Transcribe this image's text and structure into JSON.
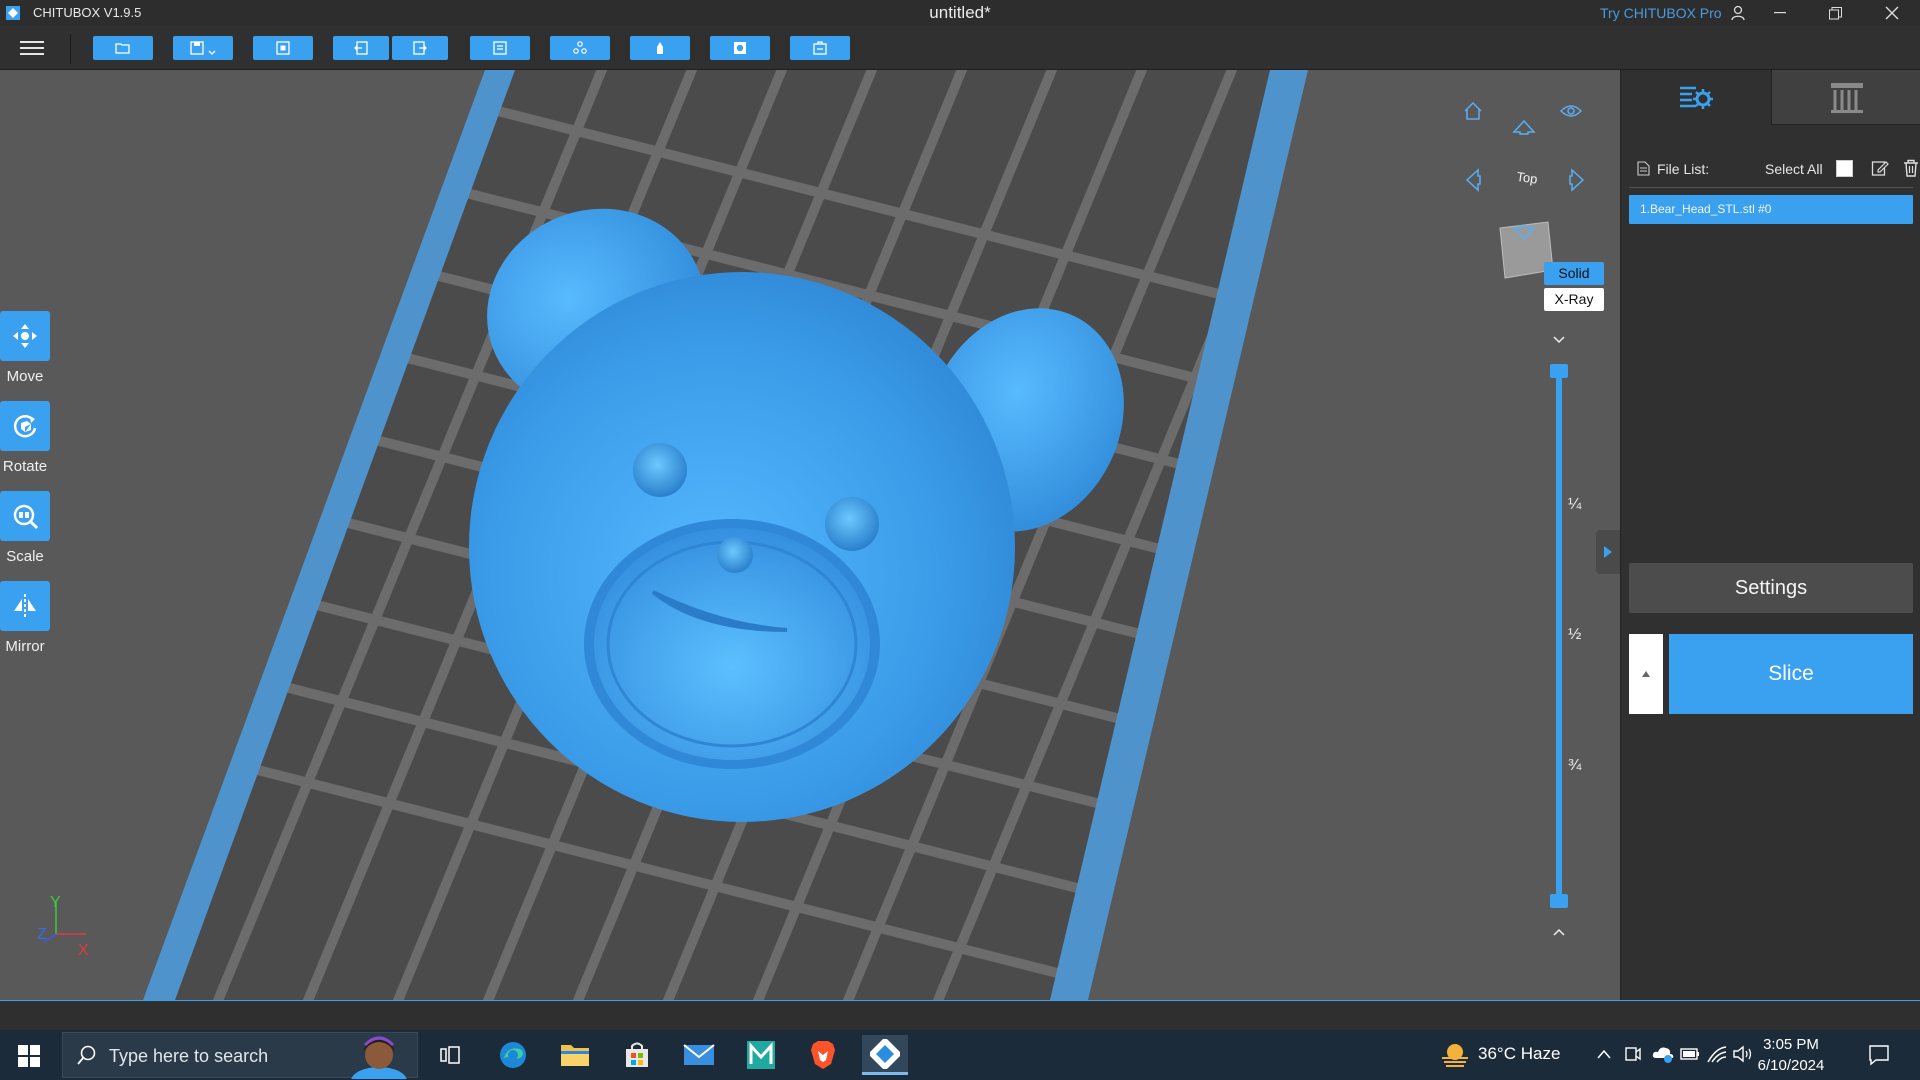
{
  "window": {
    "app_name": "CHITUBOX V1.9.5",
    "doc_title": "untitled*",
    "pro_link": "Try CHITUBOX Pro"
  },
  "toolbar": {
    "buttons": [
      "open-file-icon",
      "save-icon",
      "center-icon",
      "undo-icon",
      "redo-icon",
      "layout-icon",
      "duplicate-icon",
      "support-icon",
      "hollow-icon",
      "drill-icon"
    ]
  },
  "tools": [
    {
      "label": "Move",
      "icon": "move-icon"
    },
    {
      "label": "Rotate",
      "icon": "rotate-icon"
    },
    {
      "label": "Scale",
      "icon": "scale-icon"
    },
    {
      "label": "Mirror",
      "icon": "mirror-icon"
    }
  ],
  "view": {
    "cube_face": "Top",
    "solid_label": "Solid",
    "xray_label": "X-Ray"
  },
  "layer_slider": {
    "marks": [
      "¼",
      "½",
      "¾"
    ],
    "upper_value_fraction": 1.0,
    "lower_value_fraction": 0.0
  },
  "axis": {
    "y": "Y",
    "z": "Z",
    "x": "X"
  },
  "panel": {
    "file_list_label": "File List:",
    "select_all_label": "Select All",
    "files": [
      "1.Bear_Head_STL.stl #0"
    ],
    "settings_label": "Settings",
    "slice_label": "Slice"
  },
  "taskbar": {
    "search_placeholder": "Type here to search",
    "weather": "36°C  Haze",
    "time": "3:05 PM",
    "date": "6/10/2024"
  },
  "colors": {
    "accent": "#3aa0f0",
    "model": "#3a9be8",
    "viewport": "#595959"
  }
}
